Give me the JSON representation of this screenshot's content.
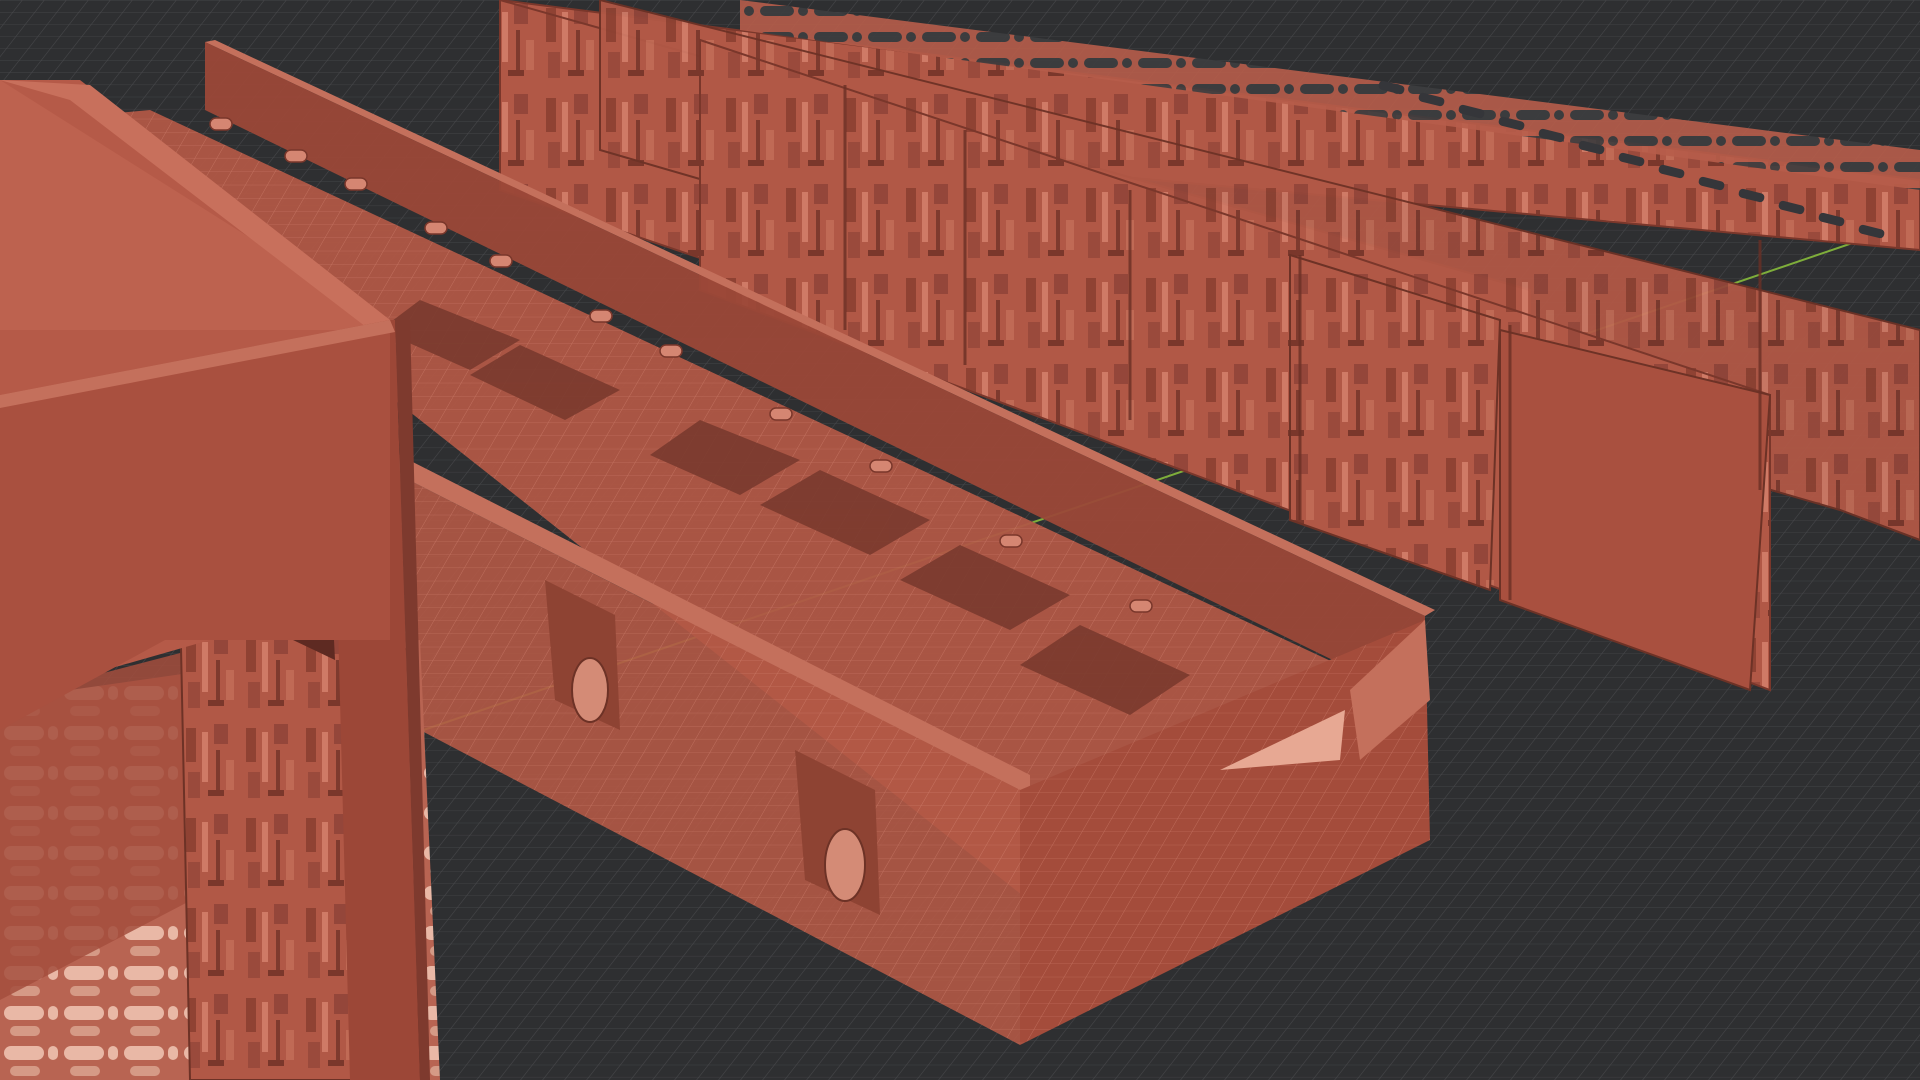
{
  "viewport": {
    "background_color": "#2e2f31",
    "grid_line_color": "#4a4b4e",
    "grid_major_color": "#56575a",
    "model_color": "#b55a48",
    "model_shadow_color": "#8e4336",
    "model_highlight_color": "#c8705c",
    "model_dark_color": "#5e2a22",
    "axis_line_color": "#8cc43c"
  },
  "objects": {
    "box": "tile-box",
    "channel": "channel-tile",
    "wall_rows": "wall-panels"
  }
}
